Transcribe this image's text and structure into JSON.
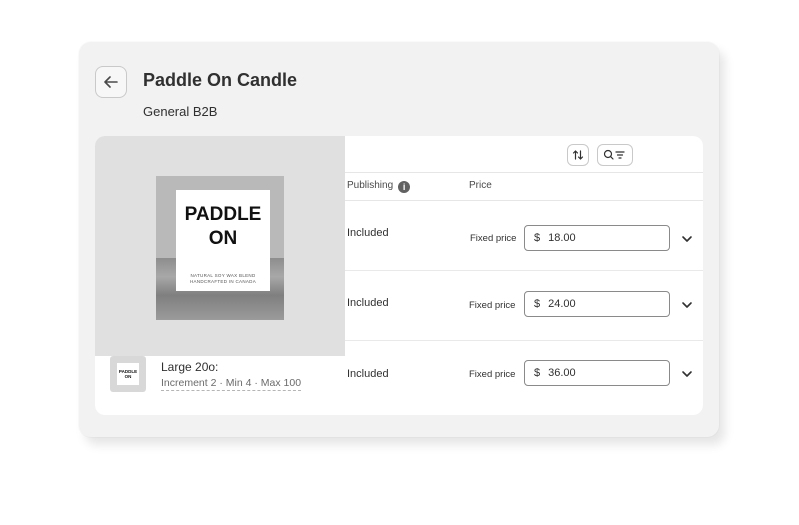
{
  "header": {
    "title": "Paddle On Candle",
    "subtitle": "General B2B"
  },
  "product_image": {
    "label_title_line1": "PADDLE",
    "label_title_line2": "ON",
    "label_sub_line1": "NATURAL SOY WAX BLEND",
    "label_sub_line2": "HANDCRAFTED IN CANADA"
  },
  "table": {
    "columns": {
      "publishing": "Publishing",
      "price": "Price"
    },
    "rows": [
      {
        "publishing": "Included",
        "price_type": "Fixed price",
        "currency": "$",
        "price": "18.00"
      },
      {
        "publishing": "Included",
        "price_type": "Fixed price",
        "currency": "$",
        "price": "24.00"
      },
      {
        "variant_name": "Large 20o:",
        "variant_meta": "Increment 2 · Min 4 · Max 100",
        "thumb_text": "PADDLE ON",
        "publishing": "Included",
        "price_type": "Fixed price",
        "currency": "$",
        "price": "36.00"
      }
    ]
  },
  "icons": {
    "back": "arrow-left-icon",
    "sort": "sort-arrows-icon",
    "search_filter": "search-filter-icon",
    "info": "info-icon",
    "chevron": "chevron-down-icon"
  },
  "colors": {
    "card_bg": "#f2f2f2",
    "panel_bg": "#ffffff",
    "border": "#8a8a8a",
    "text": "#303030"
  }
}
